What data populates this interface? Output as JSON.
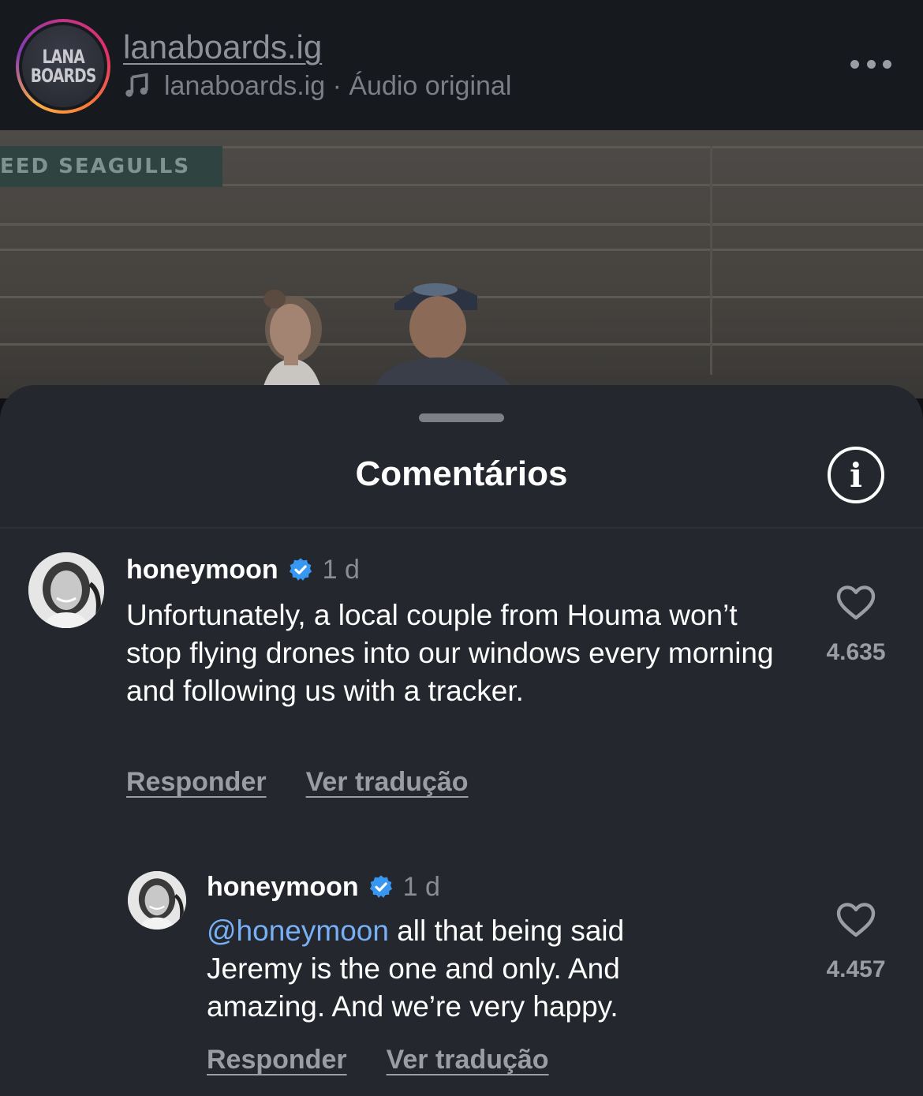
{
  "header": {
    "avatar_logo_lines": [
      "LANA",
      "BOARDS"
    ],
    "username": "lanaboards.ig",
    "audio_text": "lanaboards.ig · Áudio original"
  },
  "video": {
    "sign_text": "EED SEAGULLS"
  },
  "sheet": {
    "title": "Comentários",
    "comments": [
      {
        "user": "honeymoon",
        "verified": true,
        "time": "1 d",
        "text": "Unfortunately, a local couple from Houma won’t stop flying drones into our windows every morning and following us with a tracker.",
        "reply_label": "Responder",
        "translate_label": "Ver tradução",
        "likes": "4.635"
      },
      {
        "user": "honeymoon",
        "verified": true,
        "time": "1 d",
        "mention": "@honeymoon",
        "text": " all that being said Jeremy is the one and only. And amazing. And we’re very happy.",
        "reply_label": "Responder",
        "translate_label": "Ver tradução",
        "likes": "4.457"
      }
    ]
  },
  "colors": {
    "sheet_bg": "#24272e",
    "header_bg": "#16191d",
    "verified": "#3897f0",
    "mention": "#78b0f5"
  }
}
